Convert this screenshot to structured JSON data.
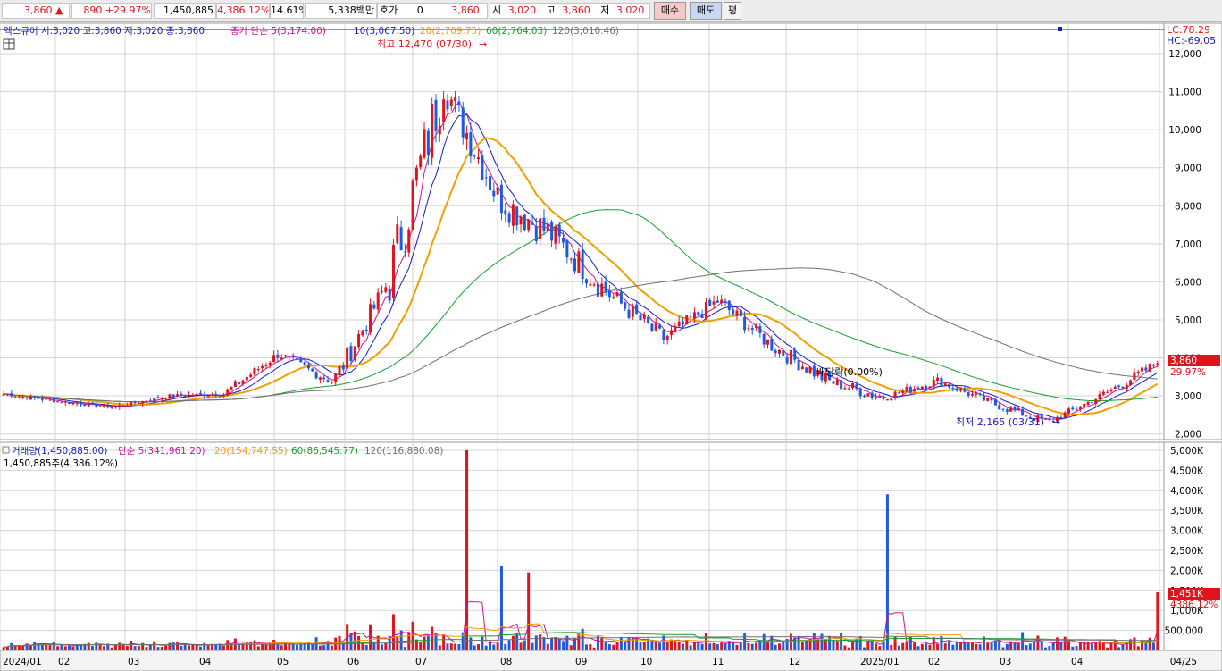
{
  "top": {
    "price": "3,860",
    "change": "890",
    "change_pct": "+29.97%",
    "volume": "1,450,885",
    "vol_ratio": "4,386.12%",
    "turnover": "14.61%",
    "amount": "5,338백만",
    "hoga_label": "호가",
    "hoga_value": "0",
    "hoga_price": "3,860",
    "open_label": "시",
    "open": "3,020",
    "high_label": "고",
    "high": "3,860",
    "low_label": "저",
    "low": "3,020",
    "buy_button": "매수",
    "sell_button": "매도",
    "avg_button": "평"
  },
  "price_legend": {
    "stock": "엑스큐어 시:3,020 고:3,860 저:3,020 종:3,860",
    "ma_title": "종가 단순 5(3,174.00)",
    "ma10": "10(3,067.50)",
    "ma20": "20(2,709.75)",
    "ma60": "60(2,764.03)",
    "ma120": "120(3,010.46)"
  },
  "price_annotations": {
    "high_note": "최고 12,470 (07/30)",
    "low_note": "최저 2,165 (03/31)",
    "dividend_note": "배당락(0.00%)",
    "lc": "LC:78.29",
    "hc": "HC:-69.05",
    "current_price": "3,860",
    "current_pct": "29.97%"
  },
  "volume_legend": {
    "title": "거래량(1,450,885.00)",
    "ma5": "단순 5(341,961.20)",
    "ma20": "20(154,747.55)",
    "ma60": "60(86,545.77)",
    "ma120": "120(116,880.08)",
    "sub": "1,450,885주(4,386.12%)",
    "current_vol": "1,451K",
    "current_pct": "4386.12%"
  },
  "colors": {
    "up": "#e0141c",
    "down": "#1e5ae0",
    "ma5": "#c8129e",
    "ma10": "#1a1ac8",
    "ma20": "#f0a000",
    "ma60": "#16a030",
    "ma120": "#707070",
    "grid": "#d4d4d4"
  },
  "chart_data": [
    {
      "type": "candlestick",
      "title": "엑스큐어",
      "ylim": [
        1850,
        12800
      ],
      "y_ticks": [
        "2,000",
        "3,000",
        "4,000",
        "5,000",
        "6,000",
        "7,000",
        "8,000",
        "9,000",
        "10,000",
        "11,000",
        "12,000"
      ],
      "x_tick_labels": [
        "2024/01",
        "02",
        "03",
        "04",
        "05",
        "06",
        "07",
        "08",
        "09",
        "10",
        "11",
        "12",
        "2025/01",
        "02",
        "03",
        "04",
        "04/25"
      ],
      "ohlc_weekly_approx": [
        {
          "x": "2024/01",
          "o": 2950,
          "h": 3200,
          "l": 2880,
          "c": 3050
        },
        {
          "x": "2024/02",
          "o": 3000,
          "h": 3100,
          "l": 2700,
          "c": 2850
        },
        {
          "x": "2024/03",
          "o": 2850,
          "h": 2950,
          "l": 2650,
          "c": 2700
        },
        {
          "x": "2024/04",
          "o": 2750,
          "h": 3150,
          "l": 2720,
          "c": 3000
        },
        {
          "x": "2024/05",
          "o": 3000,
          "h": 3200,
          "l": 2900,
          "c": 3050
        },
        {
          "x": "2024/06",
          "o": 3300,
          "h": 4300,
          "l": 3200,
          "c": 4100
        },
        {
          "x": "2024/06b",
          "o": 4100,
          "h": 4600,
          "l": 3200,
          "c": 3350
        },
        {
          "x": "2024/07",
          "o": 3400,
          "h": 6400,
          "l": 3300,
          "c": 6000
        },
        {
          "x": "2024/07b",
          "o": 6500,
          "h": 12470,
          "l": 8000,
          "c": 11200
        },
        {
          "x": "2024/08",
          "o": 11000,
          "h": 12000,
          "l": 7400,
          "c": 8200
        },
        {
          "x": "2024/08b",
          "o": 8500,
          "h": 9300,
          "l": 7000,
          "c": 7200
        },
        {
          "x": "2024/09",
          "o": 7000,
          "h": 7200,
          "l": 5000,
          "c": 5700
        },
        {
          "x": "2024/09b",
          "o": 5800,
          "h": 6300,
          "l": 4300,
          "c": 4500
        },
        {
          "x": "2024/10",
          "o": 4600,
          "h": 6300,
          "l": 4100,
          "c": 5500
        },
        {
          "x": "2024/10b",
          "o": 5500,
          "h": 5600,
          "l": 4000,
          "c": 4300
        },
        {
          "x": "2024/11",
          "o": 4200,
          "h": 4500,
          "l": 3200,
          "c": 3400
        },
        {
          "x": "2024/12",
          "o": 3400,
          "h": 3600,
          "l": 2600,
          "c": 2950
        },
        {
          "x": "2025/01",
          "o": 2900,
          "h": 3900,
          "l": 2800,
          "c": 3400
        },
        {
          "x": "2025/02",
          "o": 3400,
          "h": 3500,
          "l": 2700,
          "c": 2800
        },
        {
          "x": "2025/03",
          "o": 2800,
          "h": 2900,
          "l": 2165,
          "c": 2300
        },
        {
          "x": "2025/04",
          "o": 2350,
          "h": 3200,
          "l": 2300,
          "c": 3020
        },
        {
          "x": "04/25",
          "o": 3020,
          "h": 3860,
          "l": 3020,
          "c": 3860
        }
      ],
      "moving_averages": {
        "ma5": 3174.0,
        "ma10": 3067.5,
        "ma20": 2709.75,
        "ma60": 2764.03,
        "ma120": 3010.46
      }
    },
    {
      "type": "bar",
      "title": "거래량",
      "ylim": [
        0,
        5200000
      ],
      "y_ticks": [
        "500,000",
        "1,000K",
        "1,500K",
        "2,000K",
        "2,500K",
        "3,000K",
        "3,500K",
        "4,000K",
        "4,500K",
        "5,000K"
      ],
      "notable_bars": [
        {
          "x": "2024/07",
          "value": 1950000
        },
        {
          "x": "2024/07b",
          "value": 5000000
        },
        {
          "x": "2024/08",
          "value": 2100000
        },
        {
          "x": "2025/01",
          "value": 3900000
        },
        {
          "x": "04/25",
          "value": 1450885
        }
      ]
    }
  ]
}
